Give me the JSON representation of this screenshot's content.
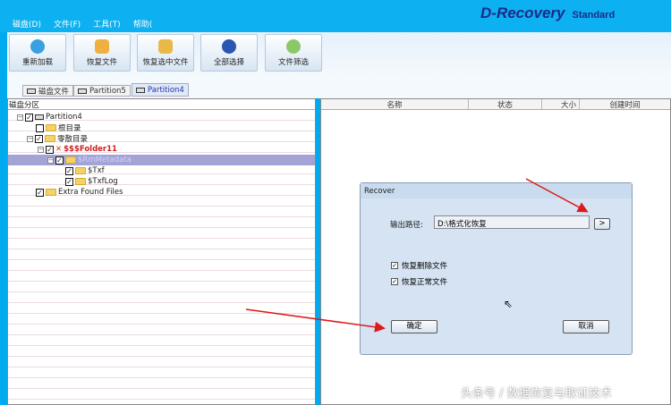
{
  "menu": [
    "磁盘(D)",
    "文件(F)",
    "工具(T)",
    "帮助("
  ],
  "logo": {
    "name": "D-Recovery",
    "edition": "Standard"
  },
  "toolbar": [
    "重新加载",
    "恢复文件",
    "恢复选中文件",
    "全部选择",
    "文件筛选"
  ],
  "tabs": [
    "磁盘文件",
    "Partition5",
    "Partition4"
  ],
  "tree": {
    "header": "磁盘分区",
    "items": [
      "Partition4",
      "根目录",
      "零散目录",
      "$$$Folder11",
      "$RmMetadata",
      "$Txf",
      "$TxfLog",
      "Extra Found Files"
    ]
  },
  "columns": [
    "名称",
    "状态",
    "大小",
    "创建时间"
  ],
  "dialog": {
    "title": "Recover",
    "path_label": "输出路径:",
    "path_value": "D:\\格式化恢复",
    "browse": ">",
    "opt1": "恢复删除文件",
    "opt2": "恢复正常文件",
    "ok": "确定",
    "cancel": "取消"
  },
  "watermark": "头条号 / 数据恢复与取证技术"
}
